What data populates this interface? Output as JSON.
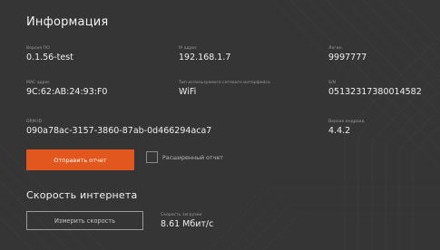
{
  "info": {
    "title": "Информация",
    "firmware": {
      "label": "Версия ПО",
      "value": "0.1.56-test"
    },
    "ip": {
      "label": "IP адрес",
      "value": "192.168.1.7"
    },
    "login": {
      "label": "Логин",
      "value": "9997777"
    },
    "mac": {
      "label": "MAC адрес",
      "value": "9C:62:AB:24:93:F0"
    },
    "net_type": {
      "label": "Тип используемого сетевого интерфейса",
      "value": "WiFi"
    },
    "sn": {
      "label": "S/N",
      "value": "05132317380014582"
    },
    "drm": {
      "label": "DRM ID",
      "value": "090a78ac-3157-3860-87ab-0d466294aca7"
    },
    "android": {
      "label": "Версия андроид",
      "value": "4.4.2"
    },
    "send_button": "Отправить отчет",
    "extended_report": {
      "label": "Расширенный отчет",
      "checked": false
    }
  },
  "speed": {
    "title": "Скорость интернета",
    "measure_button": "Измерить скорость",
    "download": {
      "label": "Скорость загрузки",
      "value": "8.61 Мбит/с"
    }
  },
  "colors": {
    "accent": "#e2571e",
    "background": "#353535"
  }
}
